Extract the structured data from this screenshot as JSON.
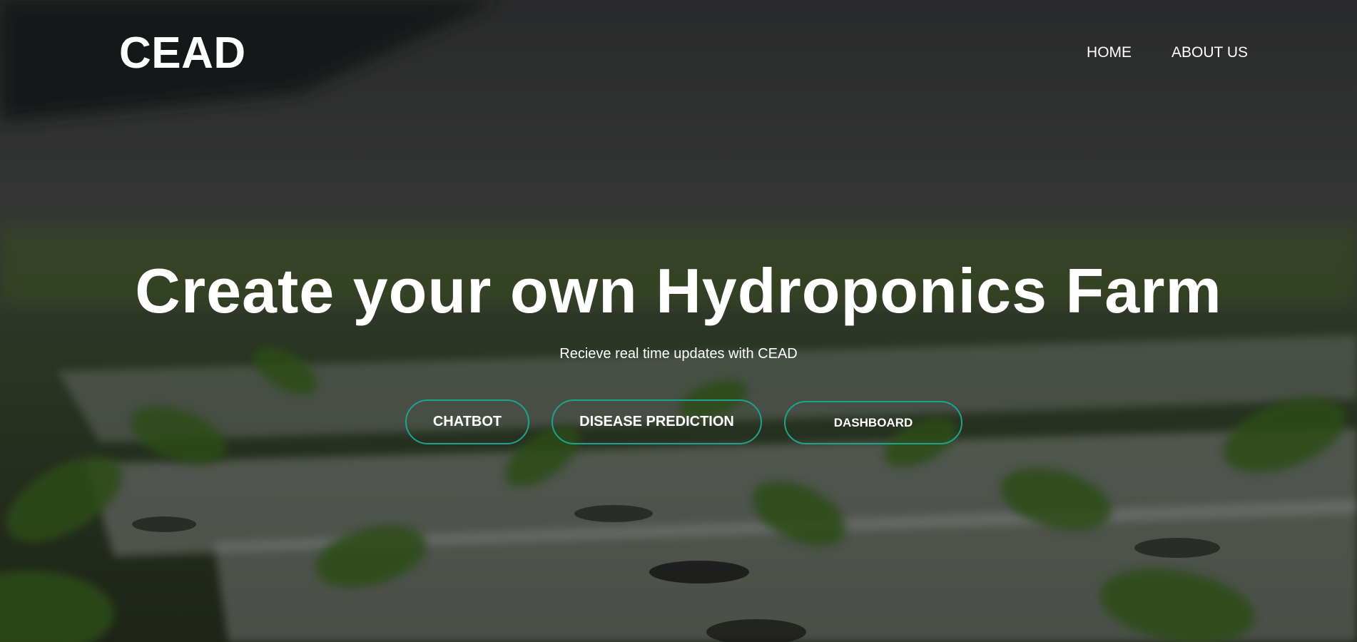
{
  "site": {
    "logo": "CEAD"
  },
  "nav": {
    "items": [
      {
        "label": "HOME"
      },
      {
        "label": "ABOUT US"
      }
    ]
  },
  "hero": {
    "headline": "Create your own Hydroponics Farm",
    "subtitle": "Recieve real time updates with CEAD",
    "background": "blurred-hydroponic-seedlings-photo"
  },
  "buttons": {
    "chatbot": "CHATBOT",
    "disease_prediction": "DISEASE PREDICTION",
    "dashboard": "DASHBOARD"
  },
  "colors": {
    "accent": "#1aa58c",
    "text": "#ffffff"
  }
}
